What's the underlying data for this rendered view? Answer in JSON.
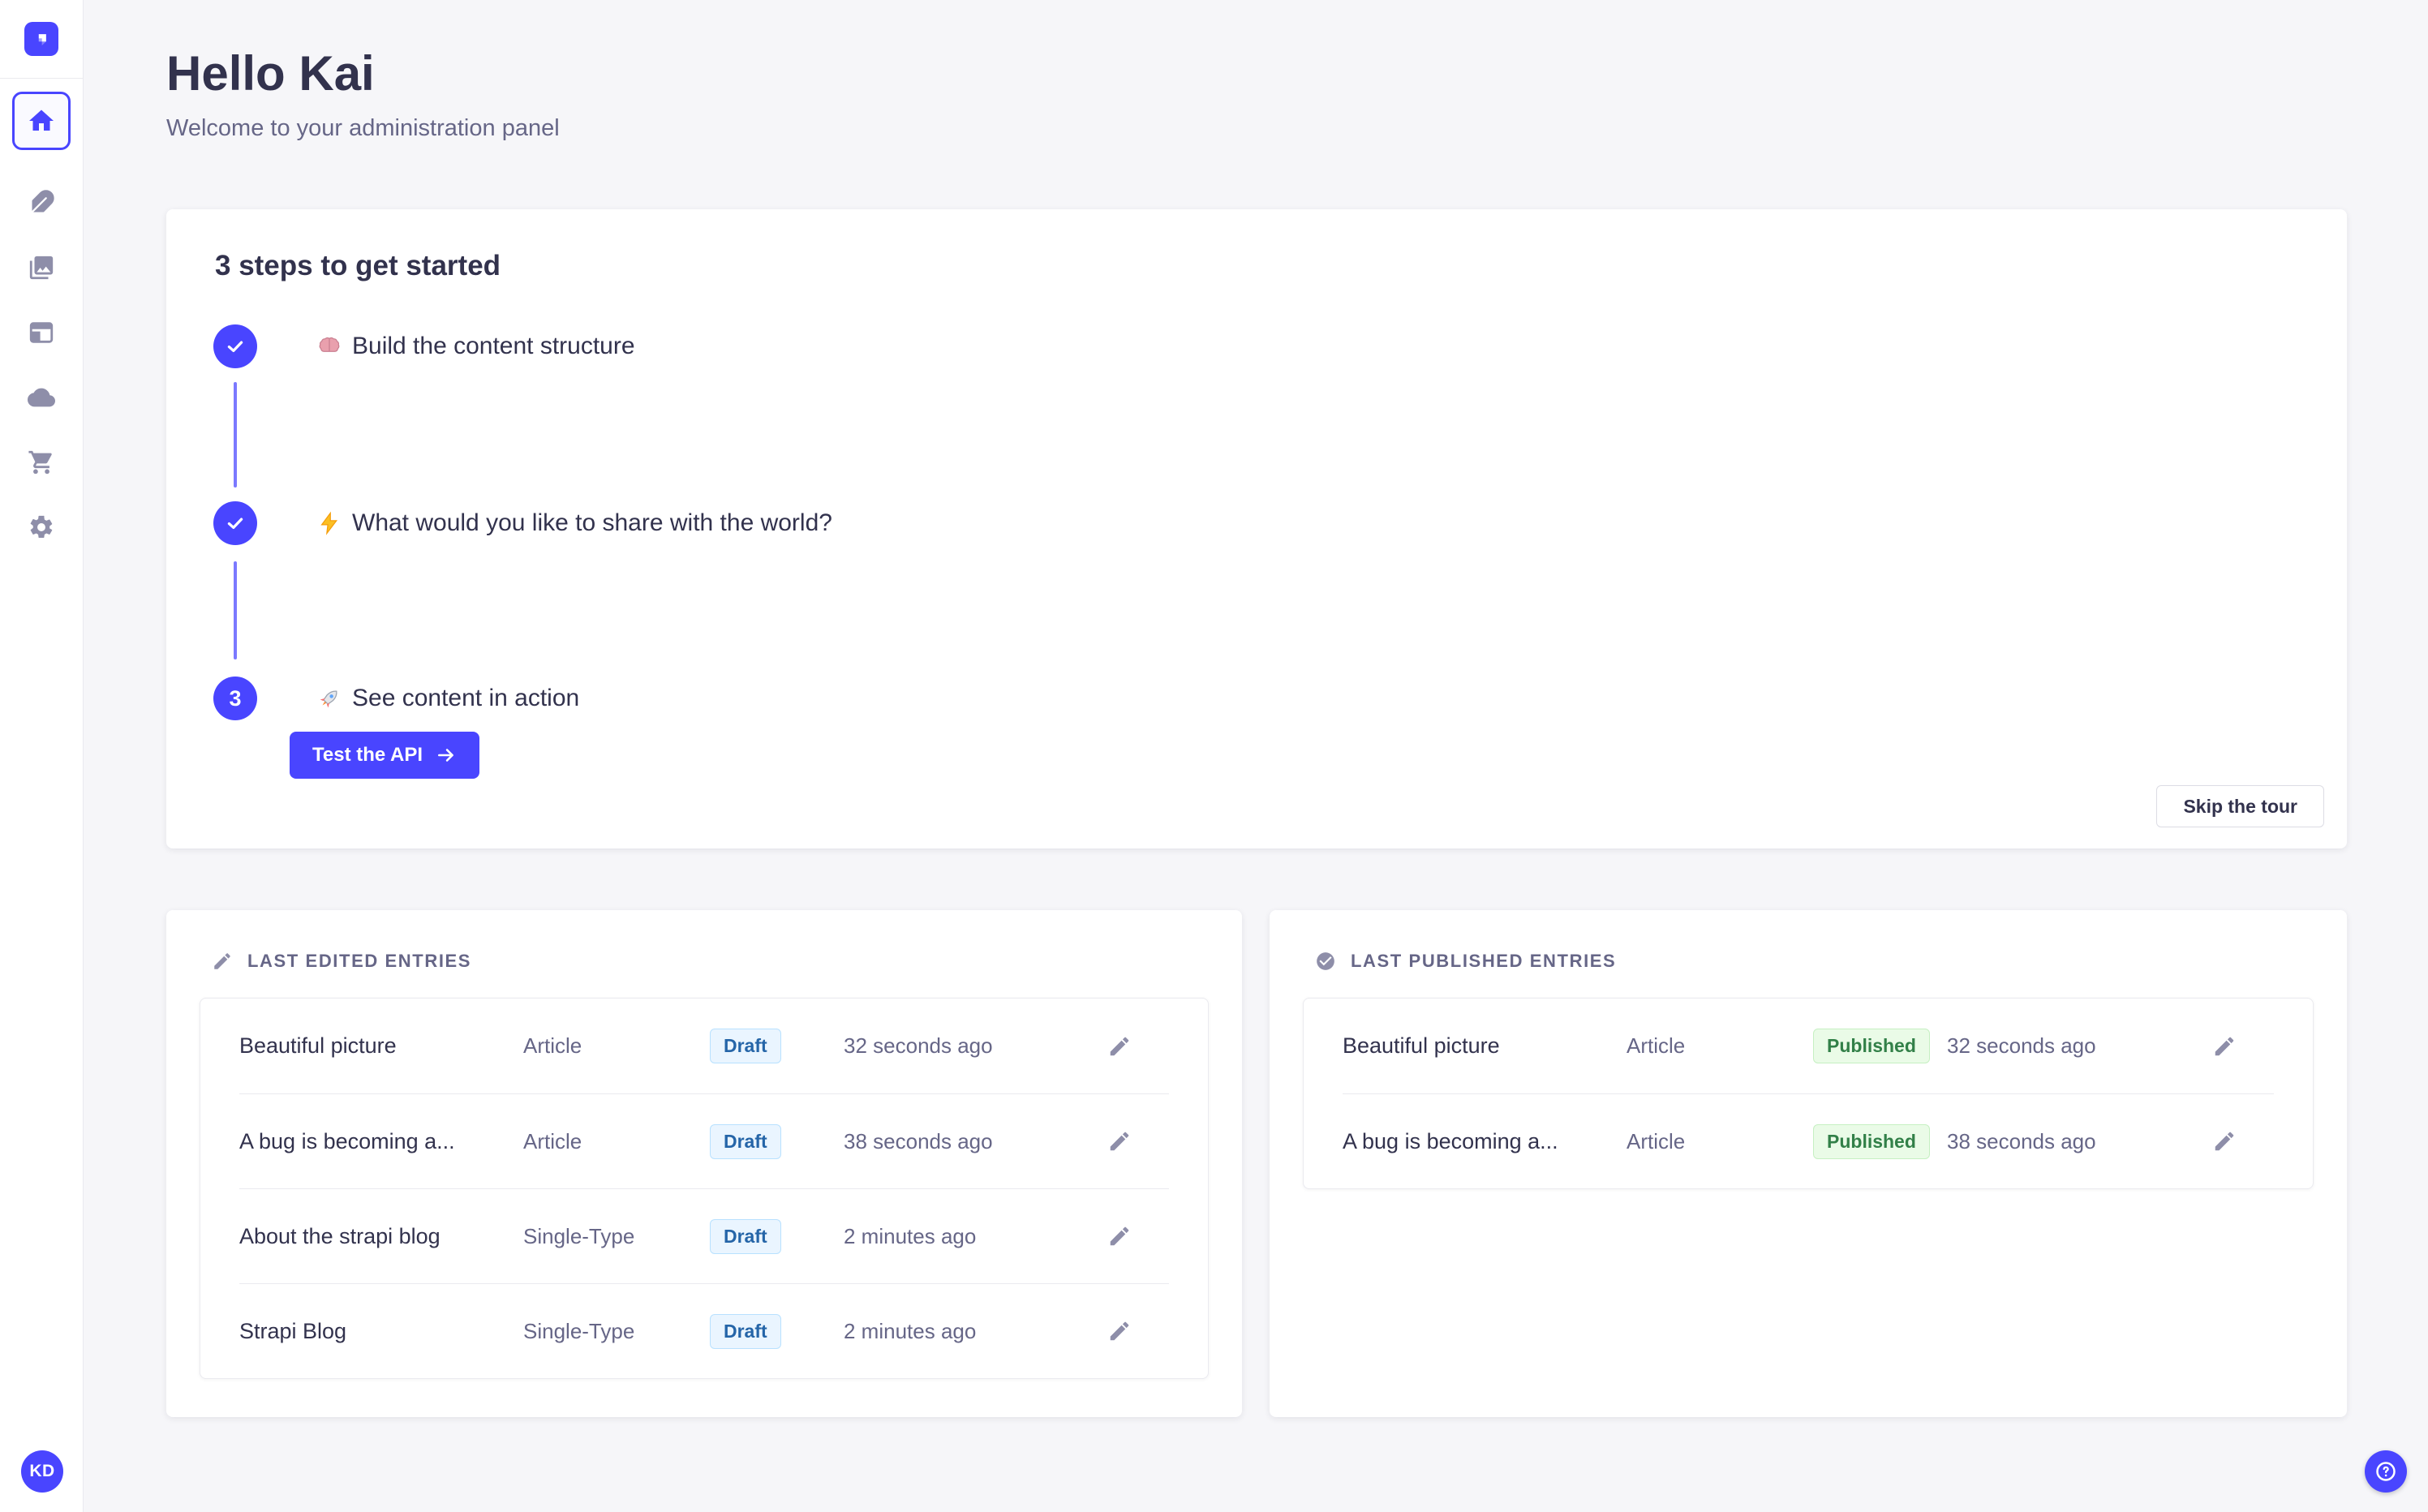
{
  "colors": {
    "accent": "#4945ff",
    "connector": "#7b79ff",
    "background": "#f6f6f9",
    "card": "#ffffff",
    "border": "#eaeaef",
    "text_dark": "#32324d",
    "text_muted": "#666687",
    "icon_gray": "#8e8ea9",
    "draft_bg": "#eaf5ff",
    "draft_border": "#b8e1ff",
    "draft_text": "#2565a8",
    "published_bg": "#eafbe7",
    "published_border": "#c6f0c2",
    "published_text": "#328048"
  },
  "sidebar": {
    "logo_icon": "strapi-logo",
    "items": [
      {
        "id": "home",
        "icon": "home-icon",
        "active": true
      },
      {
        "id": "content-manager",
        "icon": "feather-icon",
        "active": false
      },
      {
        "id": "media-library",
        "icon": "pictures-icon",
        "active": false
      },
      {
        "id": "content-type-builder",
        "icon": "layout-icon",
        "active": false
      },
      {
        "id": "cloud",
        "icon": "cloud-icon",
        "active": false
      },
      {
        "id": "marketplace",
        "icon": "cart-icon",
        "active": false
      },
      {
        "id": "settings",
        "icon": "gear-icon",
        "active": false
      }
    ],
    "avatar_initials": "KD"
  },
  "header": {
    "title": "Hello Kai",
    "subtitle": "Welcome to your administration panel"
  },
  "onboarding": {
    "title": "3 steps to get started",
    "steps": [
      {
        "status": "done",
        "emoji": "🧠",
        "emoji_name": "brain-emoji",
        "label": "Build the content structure"
      },
      {
        "status": "done",
        "emoji": "⚡",
        "emoji_name": "zap-emoji",
        "label": "What would you like to share with the world?"
      },
      {
        "status": "current",
        "number": "3",
        "emoji": "🚀",
        "emoji_name": "rocket-emoji",
        "label": "See content in action"
      }
    ],
    "cta_label": "Test the API",
    "skip_label": "Skip the tour"
  },
  "widgets": [
    {
      "icon": "pencil-icon",
      "title": "LAST EDITED ENTRIES",
      "rows": [
        {
          "title": "Beautiful picture",
          "kind": "Article",
          "status": "Draft",
          "time": "32 seconds ago"
        },
        {
          "title": "A bug is becoming a...",
          "kind": "Article",
          "status": "Draft",
          "time": "38 seconds ago"
        },
        {
          "title": "About the strapi blog",
          "kind": "Single-Type",
          "status": "Draft",
          "time": "2 minutes ago"
        },
        {
          "title": "Strapi Blog",
          "kind": "Single-Type",
          "status": "Draft",
          "time": "2 minutes ago"
        }
      ]
    },
    {
      "icon": "check-circle-icon",
      "title": "LAST PUBLISHED ENTRIES",
      "rows": [
        {
          "title": "Beautiful picture",
          "kind": "Article",
          "status": "Published",
          "time": "32 seconds ago"
        },
        {
          "title": "A bug is becoming a...",
          "kind": "Article",
          "status": "Published",
          "time": "38 seconds ago"
        }
      ]
    }
  ],
  "help": {
    "icon": "help-icon"
  }
}
